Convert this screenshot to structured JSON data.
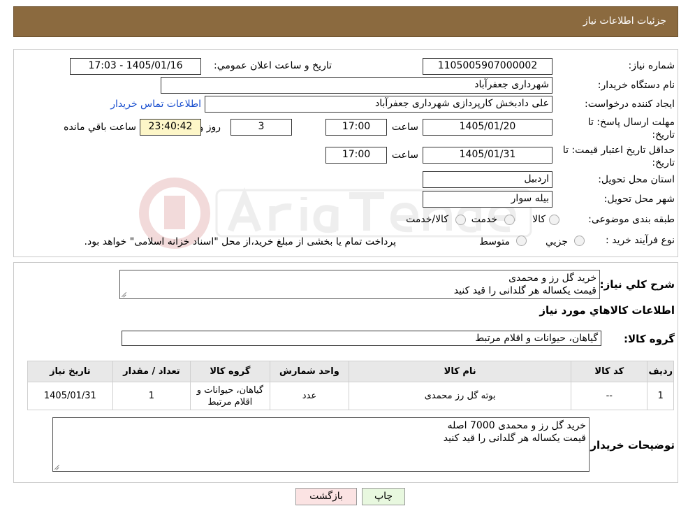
{
  "header": {
    "title": "جزئیات اطلاعات نیاز"
  },
  "form": {
    "need_number_label": "شماره نیاز:",
    "need_number": "1105005907000002",
    "announce_label": "تاریخ و ساعت اعلان عمومي:",
    "announce_value": "1405/01/16 - 17:03",
    "buyer_org_label": "نام دستگاه خریدار:",
    "buyer_org": "شهرداری جعفرآباد",
    "requester_label": "ایجاد کننده درخواست:",
    "requester": "علی دادبخش کارپردازی شهرداری جعفرآباد",
    "contact_link": "اطلاعات تماس خریدار",
    "deadline_label": "مهلت ارسال پاسخ: تا تاریخ:",
    "deadline_date": "1405/01/20",
    "time_label": "ساعت",
    "deadline_time": "17:00",
    "days": "3",
    "days_label": "روز و",
    "remaining": "23:40:42",
    "remaining_label": "ساعت باقي مانده",
    "validity_label": "حداقل تاریخ اعتبار قیمت: تا تاریخ:",
    "validity_date": "1405/01/31",
    "validity_time": "17:00",
    "province_label": "استان محل تحویل:",
    "province": "اردبیل",
    "city_label": "شهر محل تحویل:",
    "city": "بیله سوار",
    "category_label": "طبقه بندی موضوعی:",
    "category_options": [
      "کالا",
      "خدمت",
      "کالا/خدمت"
    ],
    "process_label": "نوع فرآیند خرید :",
    "process_options": [
      "جزيي",
      "متوسط"
    ],
    "process_note": "پرداخت تمام یا بخشی از مبلغ خرید،از محل \"اسناد خزانه اسلامی\" خواهد بود."
  },
  "summary": {
    "label": "شرح كلي نياز:",
    "line1": "خرید گل رز و محمدی",
    "line2": "قیمت یکساله هر گلدانی را قید کنید"
  },
  "goods": {
    "section_title": "اطلاعات كالاهاي مورد نياز",
    "group_label": "گروه کالا:",
    "group_value": "گیاهان، حیوانات و اقلام مرتبط"
  },
  "table": {
    "headers": [
      "رديف",
      "كد كالا",
      "نام كالا",
      "واحد شمارش",
      "گروه كالا",
      "تعداد / مقدار",
      "تاريخ نياز"
    ],
    "rows": [
      {
        "row": "1",
        "code": "--",
        "name": "بوته گل رز محمدی",
        "unit": "عدد",
        "group": "گیاهان، حیوانات و اقلام مرتبط",
        "qty": "1",
        "date": "1405/01/31"
      }
    ]
  },
  "buyer_notes": {
    "label": "توضیحات خریدار:",
    "line1": "خرید گل رز و محمدی 7000 اصله",
    "line2": "قیمت یکساله هر گلدانی را قید کنید"
  },
  "buttons": {
    "print": "چاپ",
    "back": "بازگشت"
  },
  "colors": {
    "header_bg": "#8b6a3f",
    "link": "#1a4fcf",
    "print_bg": "#e8f8df",
    "back_bg": "#fbe3e3",
    "timer_bg": "#fdf6c8"
  }
}
